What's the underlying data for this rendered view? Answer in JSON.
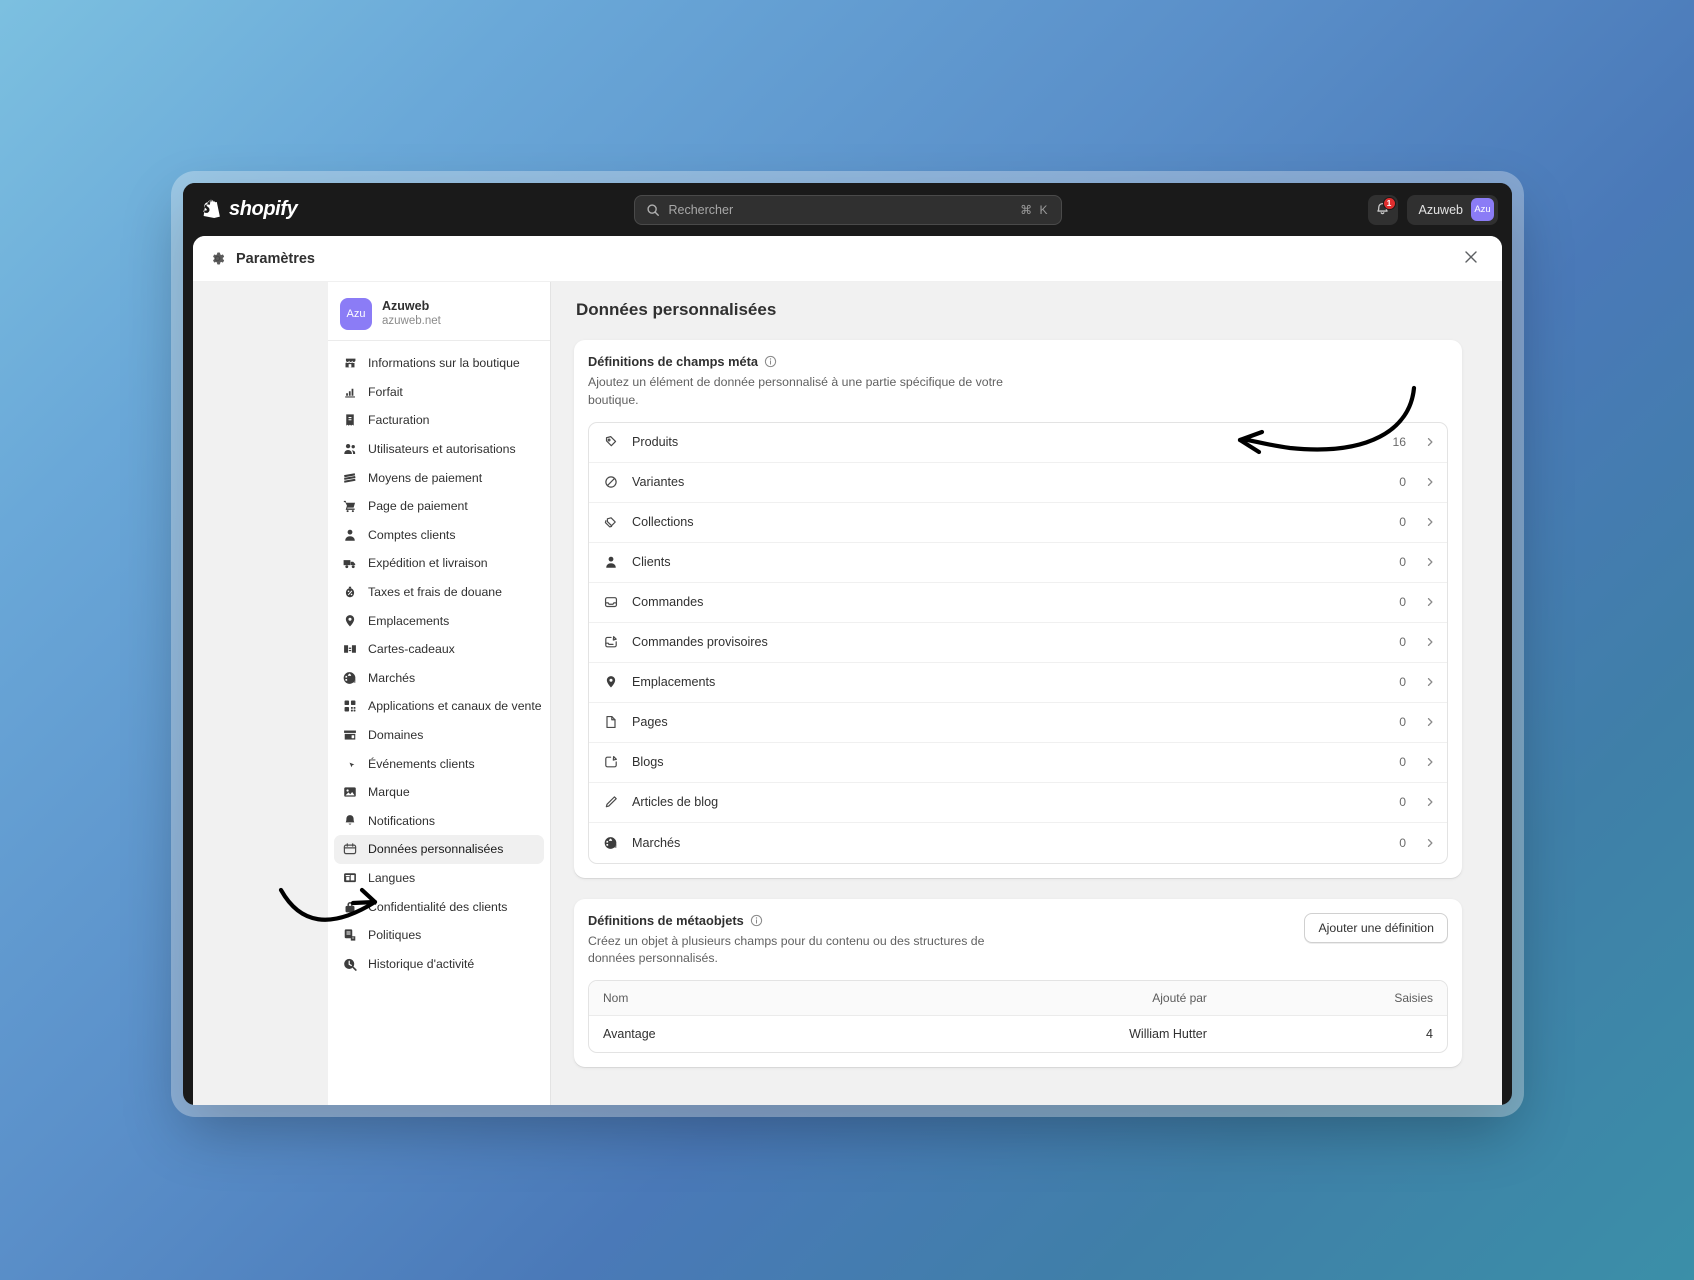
{
  "topbar": {
    "brand": "shopify",
    "brand_icon": "shopify-bag-icon",
    "search": {
      "placeholder": "Rechercher",
      "value": "",
      "icon": "search-icon",
      "shortcut": "⌘ K"
    },
    "notifications": {
      "icon": "bell-icon",
      "badge": "1"
    },
    "account": {
      "name": "Azuweb",
      "avatar_initials": "Azu",
      "avatar_color": "#8b7cf6"
    }
  },
  "modal": {
    "title": "Paramètres",
    "gear_icon": "gear-icon",
    "close_icon": "close-icon"
  },
  "sidebar": {
    "shop": {
      "name": "Azuweb",
      "domain": "azuweb.net",
      "avatar_initials": "Azu"
    },
    "items": [
      {
        "label": "Informations sur la boutique",
        "icon": "store-icon",
        "active": false
      },
      {
        "label": "Forfait",
        "icon": "chart-bars-icon",
        "active": false
      },
      {
        "label": "Facturation",
        "icon": "receipt-icon",
        "active": false
      },
      {
        "label": "Utilisateurs et autorisations",
        "icon": "users-icon",
        "active": false
      },
      {
        "label": "Moyens de paiement",
        "icon": "credit-card-icon",
        "active": false
      },
      {
        "label": "Page de paiement",
        "icon": "cart-icon",
        "active": false
      },
      {
        "label": "Comptes clients",
        "icon": "person-icon",
        "active": false
      },
      {
        "label": "Expédition et livraison",
        "icon": "delivery-truck-icon",
        "active": false
      },
      {
        "label": "Taxes et frais de douane",
        "icon": "tax-icon",
        "active": false
      },
      {
        "label": "Emplacements",
        "icon": "location-pin-icon",
        "active": false
      },
      {
        "label": "Cartes-cadeaux",
        "icon": "gift-card-icon",
        "active": false
      },
      {
        "label": "Marchés",
        "icon": "globe-icon",
        "active": false
      },
      {
        "label": "Applications et canaux de vente",
        "icon": "apps-grid-icon",
        "active": false
      },
      {
        "label": "Domaines",
        "icon": "domain-icon",
        "active": false
      },
      {
        "label": "Événements clients",
        "icon": "click-event-icon",
        "active": false
      },
      {
        "label": "Marque",
        "icon": "brand-image-icon",
        "active": false
      },
      {
        "label": "Notifications",
        "icon": "bell-icon",
        "active": false
      },
      {
        "label": "Données personnalisées",
        "icon": "metafields-icon",
        "active": true
      },
      {
        "label": "Langues",
        "icon": "translate-icon",
        "active": false
      },
      {
        "label": "Confidentialité des clients",
        "icon": "lock-icon",
        "active": false
      },
      {
        "label": "Politiques",
        "icon": "policy-icon",
        "active": false
      },
      {
        "label": "Historique d'activité",
        "icon": "activity-history-icon",
        "active": false
      }
    ]
  },
  "main": {
    "page_title": "Données personnalisées",
    "metafields_card": {
      "title": "Définitions de champs méta",
      "info_icon": "info-circle-icon",
      "description": "Ajoutez un élément de donnée personnalisé à une partie spécifique de votre boutique.",
      "rows": [
        {
          "label": "Produits",
          "count": "16",
          "icon": "product-tag-icon"
        },
        {
          "label": "Variantes",
          "count": "0",
          "icon": "variant-icon"
        },
        {
          "label": "Collections",
          "count": "0",
          "icon": "collection-icon"
        },
        {
          "label": "Clients",
          "count": "0",
          "icon": "person-icon"
        },
        {
          "label": "Commandes",
          "count": "0",
          "icon": "order-inbox-icon"
        },
        {
          "label": "Commandes provisoires",
          "count": "0",
          "icon": "draft-order-icon"
        },
        {
          "label": "Emplacements",
          "count": "0",
          "icon": "location-pin-icon"
        },
        {
          "label": "Pages",
          "count": "0",
          "icon": "page-icon"
        },
        {
          "label": "Blogs",
          "count": "0",
          "icon": "blog-icon"
        },
        {
          "label": "Articles de blog",
          "count": "0",
          "icon": "pencil-icon"
        },
        {
          "label": "Marchés",
          "count": "0",
          "icon": "globe-icon"
        }
      ],
      "chevron_icon": "chevron-right-icon"
    },
    "metaobjects_card": {
      "title": "Définitions de métaobjets",
      "info_icon": "info-circle-icon",
      "description": "Créez un objet à plusieurs champs pour du contenu ou des structures de données personnalisés.",
      "add_button": "Ajouter une définition",
      "columns": [
        "Nom",
        "Ajouté par",
        "Saisies"
      ],
      "rows": [
        {
          "name": "Avantage",
          "added_by": "William Hutter",
          "entries": "4"
        }
      ]
    }
  }
}
